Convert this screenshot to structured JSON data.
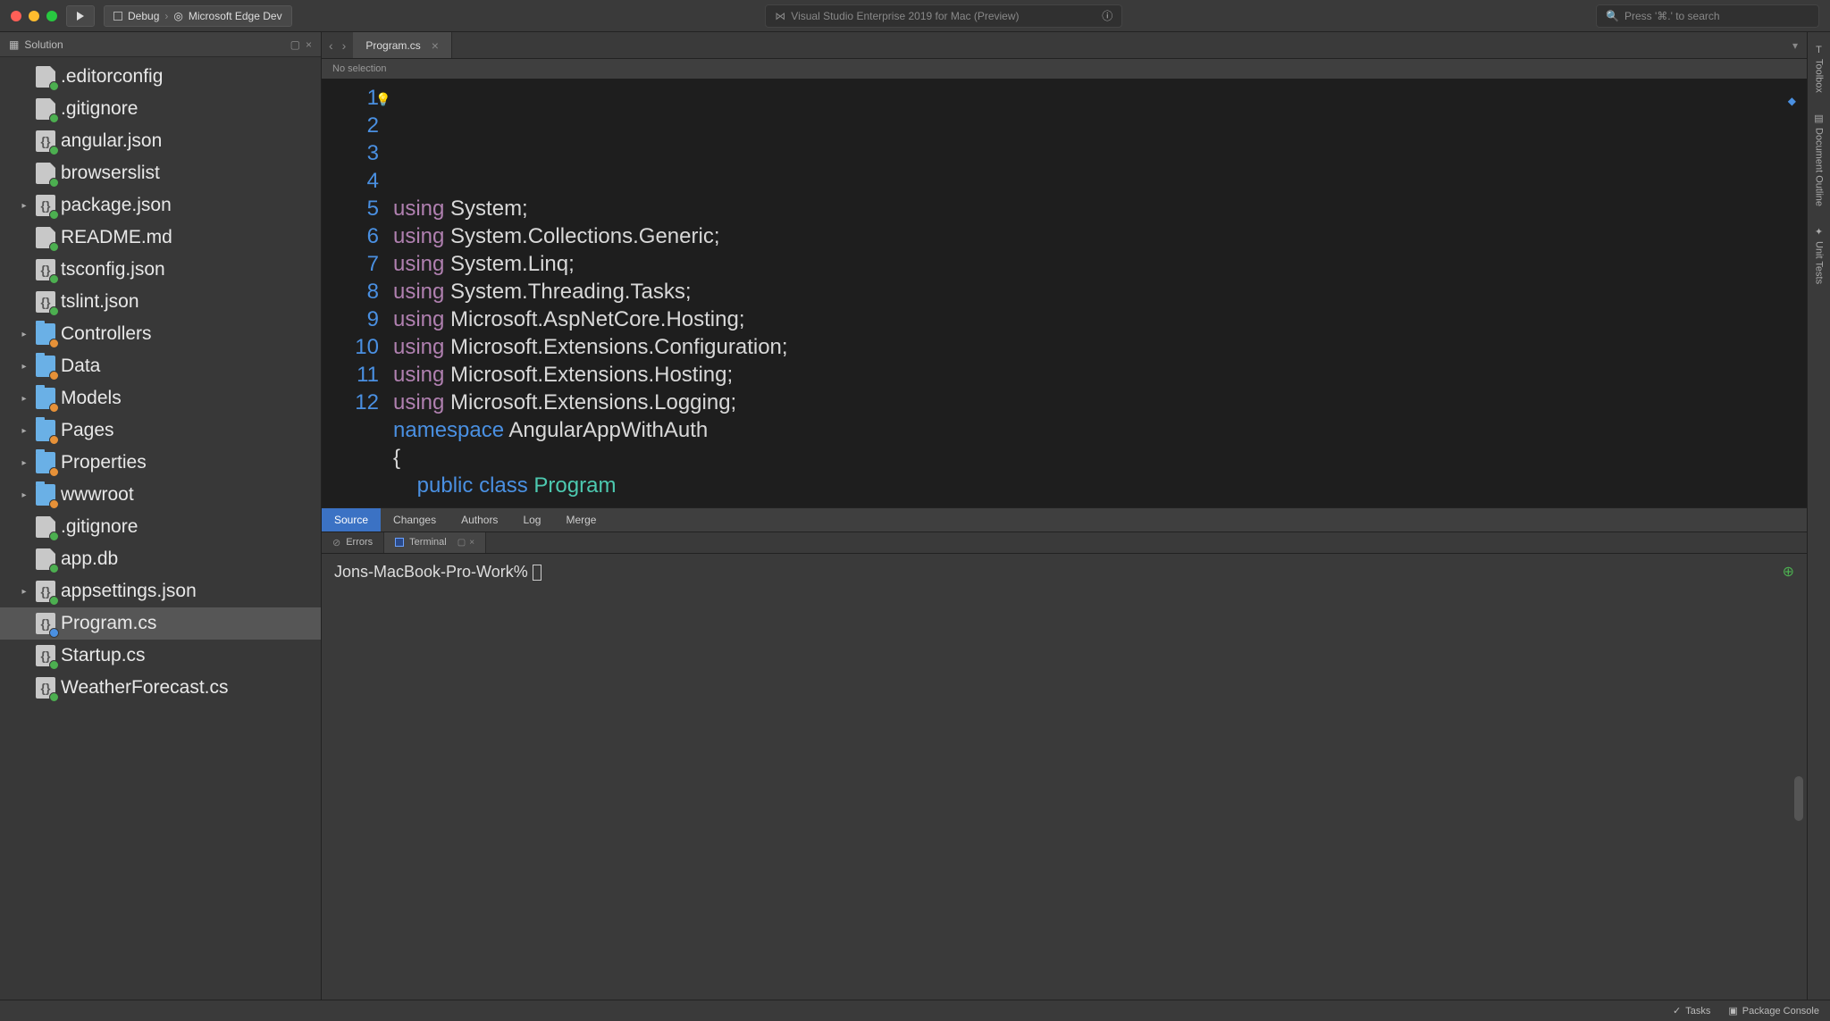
{
  "titlebar": {
    "breadcrumb_config": "Debug",
    "breadcrumb_target": "Microsoft Edge Dev",
    "app_title": "Visual Studio Enterprise 2019 for Mac (Preview)",
    "search_placeholder": "Press '⌘.' to search"
  },
  "sidebar": {
    "title": "Solution",
    "items": [
      {
        "name": ".editorconfig",
        "icon": "file",
        "badge": "green",
        "exp": ""
      },
      {
        "name": ".gitignore",
        "icon": "file",
        "badge": "green",
        "exp": ""
      },
      {
        "name": "angular.json",
        "icon": "json",
        "badge": "green",
        "exp": ""
      },
      {
        "name": "browserslist",
        "icon": "file",
        "badge": "green",
        "exp": ""
      },
      {
        "name": "package.json",
        "icon": "json",
        "badge": "green",
        "exp": "▸"
      },
      {
        "name": "README.md",
        "icon": "file",
        "badge": "green",
        "exp": ""
      },
      {
        "name": "tsconfig.json",
        "icon": "json",
        "badge": "green",
        "exp": ""
      },
      {
        "name": "tslint.json",
        "icon": "json",
        "badge": "green",
        "exp": ""
      },
      {
        "name": "Controllers",
        "icon": "folder",
        "badge": "orange",
        "exp": "▸"
      },
      {
        "name": "Data",
        "icon": "folder",
        "badge": "orange",
        "exp": "▸"
      },
      {
        "name": "Models",
        "icon": "folder",
        "badge": "orange",
        "exp": "▸"
      },
      {
        "name": "Pages",
        "icon": "folder",
        "badge": "orange",
        "exp": "▸"
      },
      {
        "name": "Properties",
        "icon": "folder",
        "badge": "orange",
        "exp": "▸"
      },
      {
        "name": "wwwroot",
        "icon": "folder",
        "badge": "orange",
        "exp": "▸"
      },
      {
        "name": ".gitignore",
        "icon": "file",
        "badge": "green",
        "exp": ""
      },
      {
        "name": "app.db",
        "icon": "file",
        "badge": "green",
        "exp": ""
      },
      {
        "name": "appsettings.json",
        "icon": "json",
        "badge": "green",
        "exp": "▸"
      },
      {
        "name": "Program.cs",
        "icon": "json",
        "badge": "blue",
        "exp": "",
        "selected": true
      },
      {
        "name": "Startup.cs",
        "icon": "json",
        "badge": "green",
        "exp": ""
      },
      {
        "name": "WeatherForecast.cs",
        "icon": "json",
        "badge": "green",
        "exp": ""
      }
    ]
  },
  "editor": {
    "tab_name": "Program.cs",
    "breadcrumb": "No selection",
    "lines": [
      {
        "n": 1,
        "tokens": [
          [
            "kw-using",
            "using"
          ],
          [
            "",
            " System;"
          ]
        ]
      },
      {
        "n": 2,
        "tokens": [
          [
            "kw-using",
            "using"
          ],
          [
            "",
            " System.Collections.Generic;"
          ]
        ]
      },
      {
        "n": 3,
        "tokens": [
          [
            "kw-using",
            "using"
          ],
          [
            "",
            " System.Linq;"
          ]
        ]
      },
      {
        "n": 4,
        "tokens": [
          [
            "kw-using",
            "using"
          ],
          [
            "",
            " System.Threading.Tasks;"
          ]
        ]
      },
      {
        "n": 5,
        "tokens": [
          [
            "kw-using",
            "using"
          ],
          [
            "",
            " Microsoft.AspNetCore.Hosting;"
          ]
        ]
      },
      {
        "n": 6,
        "tokens": [
          [
            "kw-using",
            "using"
          ],
          [
            "",
            " Microsoft.Extensions.Configuration;"
          ]
        ]
      },
      {
        "n": 7,
        "tokens": [
          [
            "kw-using",
            "using"
          ],
          [
            "",
            " Microsoft.Extensions.Hosting;"
          ]
        ]
      },
      {
        "n": 8,
        "tokens": [
          [
            "kw-using",
            "using"
          ],
          [
            "",
            " Microsoft.Extensions.Logging;"
          ]
        ]
      },
      {
        "n": 9,
        "tokens": [
          [
            "",
            ""
          ]
        ]
      },
      {
        "n": 10,
        "tokens": [
          [
            "kw-ns",
            "namespace"
          ],
          [
            "",
            " AngularAppWithAuth"
          ]
        ]
      },
      {
        "n": 11,
        "tokens": [
          [
            "",
            "{"
          ]
        ]
      },
      {
        "n": 12,
        "tokens": [
          [
            "",
            "    "
          ],
          [
            "kw-mod",
            "public"
          ],
          [
            "",
            " "
          ],
          [
            "kw-mod",
            "class"
          ],
          [
            "",
            " "
          ],
          [
            "kw-type",
            "Program"
          ]
        ]
      }
    ]
  },
  "bottom_tabs": [
    "Source",
    "Changes",
    "Authors",
    "Log",
    "Merge"
  ],
  "pad_tabs": {
    "errors": "Errors",
    "terminal": "Terminal"
  },
  "terminal": {
    "prompt": "Jons-MacBook-Pro-Work% "
  },
  "right_rail": [
    "Toolbox",
    "Document Outline",
    "Unit Tests"
  ],
  "statusbar": {
    "tasks": "Tasks",
    "package_console": "Package Console"
  }
}
